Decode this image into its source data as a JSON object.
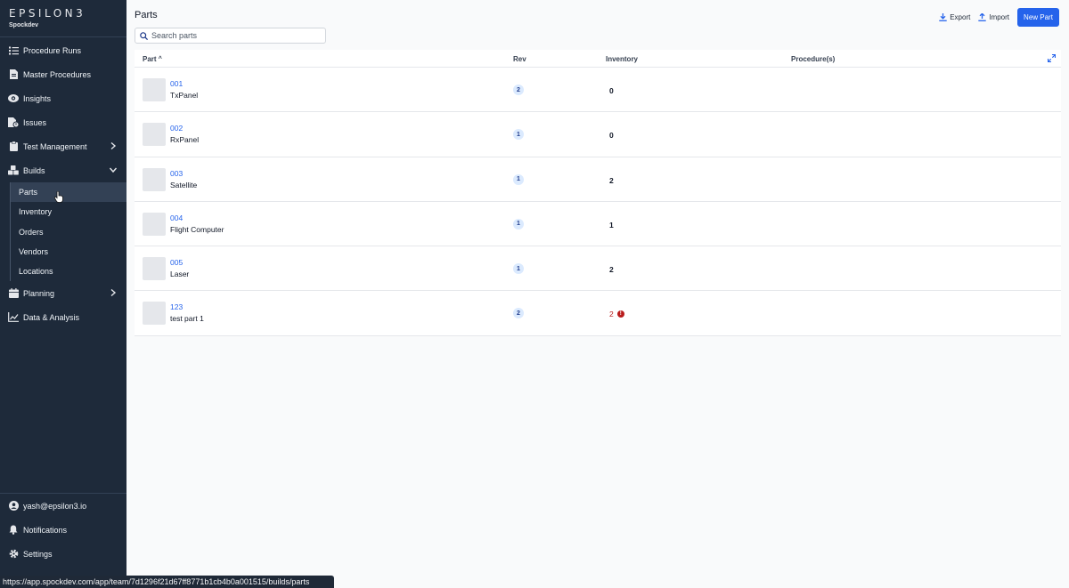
{
  "sidebar": {
    "logo": "EPSILON3",
    "team": "Spockdev",
    "nav": [
      {
        "label": "Procedure Runs",
        "icon": "list-icon"
      },
      {
        "label": "Master Procedures",
        "icon": "document-icon"
      },
      {
        "label": "Insights",
        "icon": "eye-icon"
      },
      {
        "label": "Issues",
        "icon": "file-alert-icon"
      },
      {
        "label": "Test Management",
        "icon": "clipboard-icon"
      },
      {
        "label": "Builds",
        "icon": "cubes-icon"
      }
    ],
    "builds_sub": [
      {
        "label": "Parts",
        "active": true
      },
      {
        "label": "Inventory"
      },
      {
        "label": "Orders"
      },
      {
        "label": "Vendors"
      },
      {
        "label": "Locations"
      }
    ],
    "nav_after": [
      {
        "label": "Planning",
        "icon": "calendar-icon"
      },
      {
        "label": "Data & Analysis",
        "icon": "chart-icon"
      }
    ],
    "bottom": [
      {
        "label": "yash@epsilon3.io",
        "icon": "user-icon"
      },
      {
        "label": "Notifications",
        "icon": "bell-icon"
      },
      {
        "label": "Settings",
        "icon": "gear-icon"
      }
    ]
  },
  "page": {
    "title": "Parts",
    "export_label": "Export",
    "import_label": "Import",
    "new_part_label": "New Part",
    "search_placeholder": "Search parts"
  },
  "table": {
    "columns": [
      "Part",
      "Rev",
      "Inventory",
      "Procedure(s)"
    ],
    "sort_indicator": "^",
    "rows": [
      {
        "number": "001",
        "name": "TxPanel",
        "rev": "2",
        "inventory": "0",
        "warning": false
      },
      {
        "number": "002",
        "name": "RxPanel",
        "rev": "1",
        "inventory": "0",
        "warning": false
      },
      {
        "number": "003",
        "name": "Satellite",
        "rev": "1",
        "inventory": "2",
        "warning": false
      },
      {
        "number": "004",
        "name": "Flight Computer",
        "rev": "1",
        "inventory": "1",
        "warning": false
      },
      {
        "number": "005",
        "name": "Laser",
        "rev": "1",
        "inventory": "2",
        "warning": false
      },
      {
        "number": "123",
        "name": "test part 1",
        "rev": "2",
        "inventory": "2",
        "warning": true
      }
    ]
  },
  "status_url": "https://app.spockdev.com/app/team/7d1296f21d67ff8771b1cb4b0a001515/builds/parts",
  "colors": {
    "sidebar_bg": "#1e2a3a",
    "accent": "#2563eb",
    "warning": "#b91c1c"
  }
}
